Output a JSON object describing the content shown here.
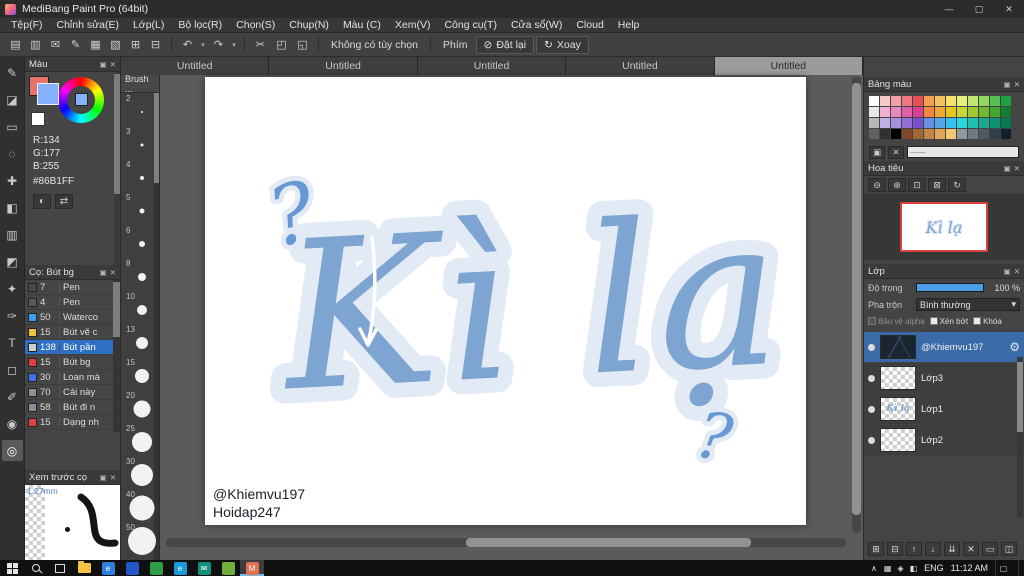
{
  "window": {
    "title": "MediBang Paint Pro (64bit)"
  },
  "icons": {
    "minimize": "—",
    "maximize": "▢",
    "close": "✕",
    "undo": "↶",
    "redo": "↷",
    "caret_down": "▾",
    "cut": "✂",
    "copy": "◰",
    "paste": "◱",
    "reset_glyph": "⊘",
    "rotate_glyph": "↻",
    "panel_float": "▣",
    "panel_close": "✕",
    "gear": "⚙",
    "sample": "◐",
    "swap": "⇄",
    "zoom_out": "⊖",
    "zoom_in": "⊕",
    "zoom_fit": "⊡",
    "zoom_actual": "⊠",
    "zoom_reset": "↻",
    "chevron_up": "∧",
    "blend_caret": "▾"
  },
  "menubar": {
    "items": [
      "Tệp(F)",
      "Chỉnh sửa(E)",
      "Lớp(L)",
      "Bộ lọc(R)",
      "Chọn(S)",
      "Chụp(N)",
      "Màu (C)",
      "Xem(V)",
      "Công cụ(T)",
      "Cửa sổ(W)",
      "Cloud",
      "Help"
    ]
  },
  "toolbar": {
    "left_icons": [
      "▤",
      "▥",
      "✉",
      "✎",
      "▦",
      "▧",
      "⊞",
      "⊟"
    ],
    "no_option_label": "Không có tùy chọn",
    "key_label": "Phím",
    "reset_label": "Đặt lại",
    "rotate_label": "Xoay"
  },
  "tabs": [
    "Untitled",
    "Untitled",
    "Untitled",
    "Untitled",
    "Untitled"
  ],
  "tools": [
    "✎",
    "◪",
    "▭",
    "◌",
    "✚",
    "◧",
    "▥",
    "◩",
    "✦",
    "✑",
    "T",
    "◻",
    "✐",
    "◉",
    "◎"
  ],
  "color_panel": {
    "title": "Màu",
    "r_label": "R:134",
    "g_label": "G:177",
    "b_label": "B:255",
    "hex_label": "#86B1FF",
    "foreground_hex": "#86b1ff",
    "background_hex": "#e8736a",
    "wheel_center_hex": "#86b1ff"
  },
  "brush_sizes": {
    "title": "Brush ...",
    "items": [
      {
        "label": "2",
        "dot": "2px"
      },
      {
        "label": "3",
        "dot": "3px"
      },
      {
        "label": "4",
        "dot": "4px"
      },
      {
        "label": "5",
        "dot": "5px"
      },
      {
        "label": "6",
        "dot": "6px"
      },
      {
        "label": "8",
        "dot": "8px"
      },
      {
        "label": "10",
        "dot": "10px"
      },
      {
        "label": "13",
        "dot": "12px"
      },
      {
        "label": "15",
        "dot": "14px"
      },
      {
        "label": "20",
        "dot": "17px"
      },
      {
        "label": "25",
        "dot": "20px"
      },
      {
        "label": "30",
        "dot": "22px"
      },
      {
        "label": "40",
        "dot": "25px"
      },
      {
        "label": "50",
        "dot": "28px"
      }
    ]
  },
  "brush_list": {
    "title": "Cọ: Bút bg",
    "items": [
      {
        "size": "7",
        "name": "Pen",
        "color": "#4a4a4a"
      },
      {
        "size": "4",
        "name": "Pen",
        "color": "#5a5a5a"
      },
      {
        "size": "50",
        "name": "Waterco",
        "color": "#3f9ef0"
      },
      {
        "size": "15",
        "name": "Bút vẽ c",
        "color": "#f0c040"
      },
      {
        "size": "138",
        "name": "Bút pần",
        "color": "#d0d0d0"
      },
      {
        "size": "15",
        "name": "Bút bg",
        "color": "#e04040"
      },
      {
        "size": "30",
        "name": "Loan mà",
        "color": "#3f70f0"
      },
      {
        "size": "70",
        "name": "Cải này",
        "color": "#909090"
      },
      {
        "size": "58",
        "name": "Bút đi n",
        "color": "#8090a0"
      },
      {
        "size": "15",
        "name": "Dạng nh",
        "color": "#e04040"
      }
    ]
  },
  "preview_panel": {
    "title": "Xem trước cọ",
    "size_label": "1.27mm"
  },
  "canvas": {
    "art_text": "Kì lạ",
    "question_mark": "?",
    "credit_line1": "@Khiemvu197",
    "credit_line2": "Hoidap247"
  },
  "palette_panel": {
    "title": "Bảng màu",
    "name_field": "——",
    "colors": [
      "#ffffff",
      "#f7c8c8",
      "#f2a0a8",
      "#ee7880",
      "#e85058",
      "#f0a050",
      "#f4c060",
      "#f8e070",
      "#e8f080",
      "#c0e870",
      "#90d860",
      "#58c050",
      "#20a040",
      "#e8e8e8",
      "#f0b0d0",
      "#e888c0",
      "#e060a8",
      "#d84090",
      "#f08840",
      "#f0a830",
      "#e8c820",
      "#c8d830",
      "#a0c830",
      "#70b830",
      "#40a830",
      "#108030",
      "#b8b8b8",
      "#c0b0e8",
      "#a890e0",
      "#9070d8",
      "#7850d0",
      "#6890e0",
      "#50a8e8",
      "#38c0f0",
      "#28d8e0",
      "#20c0b0",
      "#18a890",
      "#109070",
      "#087850",
      "#606060",
      "#303030",
      "#000000",
      "#804828",
      "#a06838",
      "#c08848",
      "#e0a858",
      "#f0c878",
      "#9098a0",
      "#707880",
      "#505860",
      "#304048",
      "#102030"
    ]
  },
  "navigator": {
    "title": "Hoa tiêu"
  },
  "layers_panel": {
    "title": "Lớp",
    "opacity_label": "Độ trong",
    "opacity_value": "100 %",
    "blend_label": "Pha trộn",
    "blend_value": "Bình thường",
    "protect_alpha_label": "Bảo vệ alpha",
    "clipping_label": "Xén bớt",
    "lock_label": "Khóa",
    "layers": [
      {
        "name": "@Khiemvu197"
      },
      {
        "name": "Lớp3"
      },
      {
        "name": "Lớp1"
      },
      {
        "name": "Lớp2"
      }
    ],
    "actions": [
      "⊞",
      "⊟",
      "↑",
      "↓",
      "⇊",
      "✕",
      "▭",
      "◫"
    ]
  },
  "taskbar": {
    "lang": "ENG",
    "time": "11:12 AM",
    "apps": [
      {
        "label": "e",
        "color": "#2f7fe0"
      },
      {
        "label": "",
        "color": "#2456c8"
      },
      {
        "label": "",
        "color": "#2e9e48"
      },
      {
        "label": "e",
        "color": "#1a9ad8"
      },
      {
        "label": "✉",
        "color": "#12907e"
      },
      {
        "label": "",
        "color": "#6fae3c"
      },
      {
        "label": "M",
        "color": "#e0704e"
      }
    ],
    "tray_icons": [
      "▦",
      "◈",
      "◧"
    ]
  }
}
